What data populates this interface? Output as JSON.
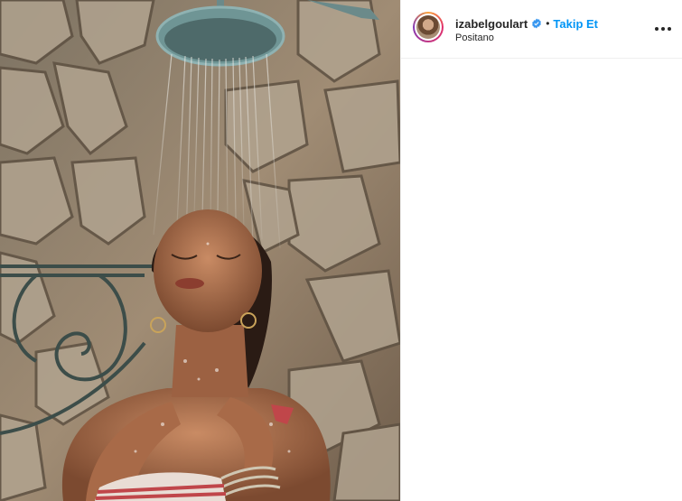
{
  "post": {
    "username": "izabelgoulart",
    "verified": true,
    "separator": "•",
    "follow_label": "Takip Et",
    "location": "Positano"
  },
  "icons": {
    "verified": "verified-badge-icon",
    "more": "more-options-icon"
  },
  "colors": {
    "follow": "#0095f6",
    "verified": "#3897f0",
    "text": "#262626"
  }
}
